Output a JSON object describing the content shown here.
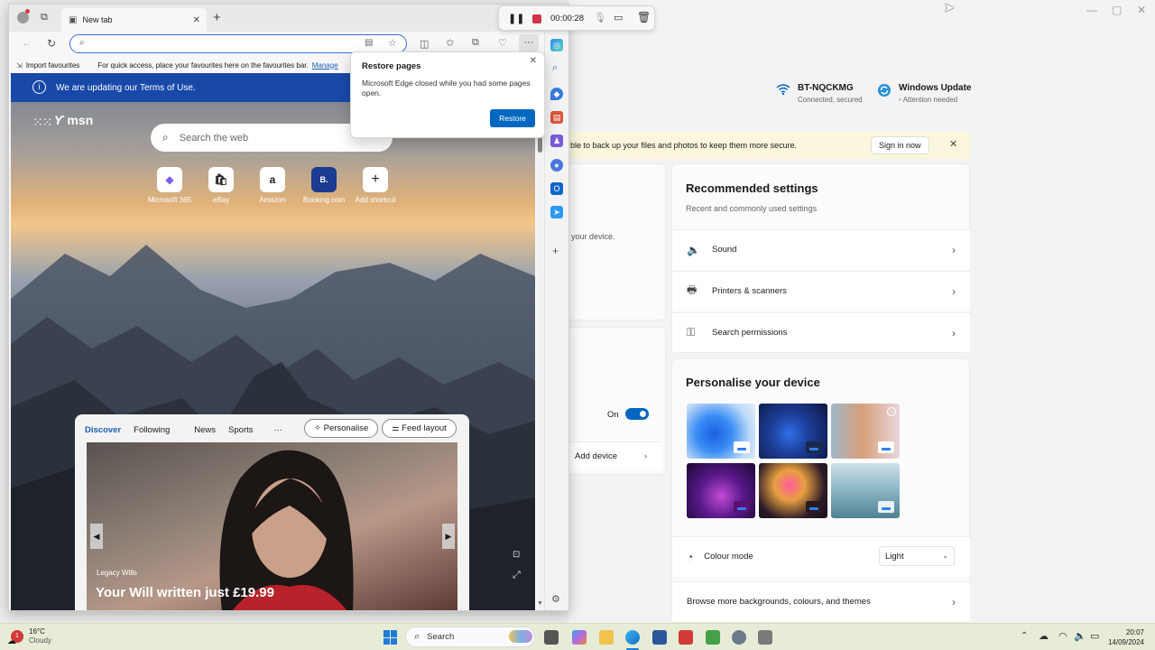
{
  "settings": {
    "network": {
      "name": "BT-NQCKMG",
      "status": "Connected, secured"
    },
    "update": {
      "name": "Windows Update",
      "status": "Attention needed"
    },
    "banner": {
      "text": "ble to back up your files and photos to keep them more secure.",
      "sign_in": "Sign in now"
    },
    "left_fragments": {
      "device_text": "your device.",
      "toggle_label": "On",
      "add_device": "Add device"
    },
    "recommended": {
      "title": "Recommended settings",
      "subtitle": "Recent and commonly used settings",
      "items": [
        {
          "label": "Sound",
          "icon": "speaker-icon"
        },
        {
          "label": "Printers & scanners",
          "icon": "printer-icon"
        },
        {
          "label": "Search permissions",
          "icon": "search-permissions-icon"
        }
      ]
    },
    "personalise": {
      "title": "Personalise your device",
      "colour_mode_label": "Colour mode",
      "colour_mode_value": "Light",
      "browse": "Browse more backgrounds, colours, and themes"
    }
  },
  "edge": {
    "tab_title": "New tab",
    "favbar": {
      "import": "Import favourites",
      "hint": "For quick access, place your favourites here on the favourites bar.",
      "manage": "Manage"
    },
    "msn": {
      "terms": "We are updating our Terms of Use.",
      "logo": "msn",
      "search_placeholder": "Search the web",
      "shortcuts": [
        {
          "label": "Microsoft 365",
          "glyph": "◆"
        },
        {
          "label": "eBay",
          "glyph": "🛍"
        },
        {
          "label": "Amazon",
          "glyph": "a"
        },
        {
          "label": "Booking.com",
          "glyph": "B."
        },
        {
          "label": "Add shortcut",
          "glyph": "+"
        }
      ],
      "feed_tabs": [
        "Discover",
        "Following",
        "News",
        "Sports",
        "···"
      ],
      "personalise": "Personalise",
      "feed_layout": "Feed layout",
      "article_source": "Legacy Wills",
      "article_title": "Your Will written just £19.99"
    },
    "popup": {
      "title": "Restore pages",
      "body": "Microsoft Edge closed while you had some pages open.",
      "button": "Restore"
    }
  },
  "recorder": {
    "time": "00:00:28"
  },
  "taskbar": {
    "weather_temp": "16°C",
    "weather_desc": "Cloudy",
    "weather_badge": "1",
    "search": "Search",
    "time": "20:07",
    "date": "14/09/2024"
  },
  "colors": {
    "accent": "#0067c0",
    "edge_blue": "#1849a9",
    "record_red": "#d1344b"
  }
}
